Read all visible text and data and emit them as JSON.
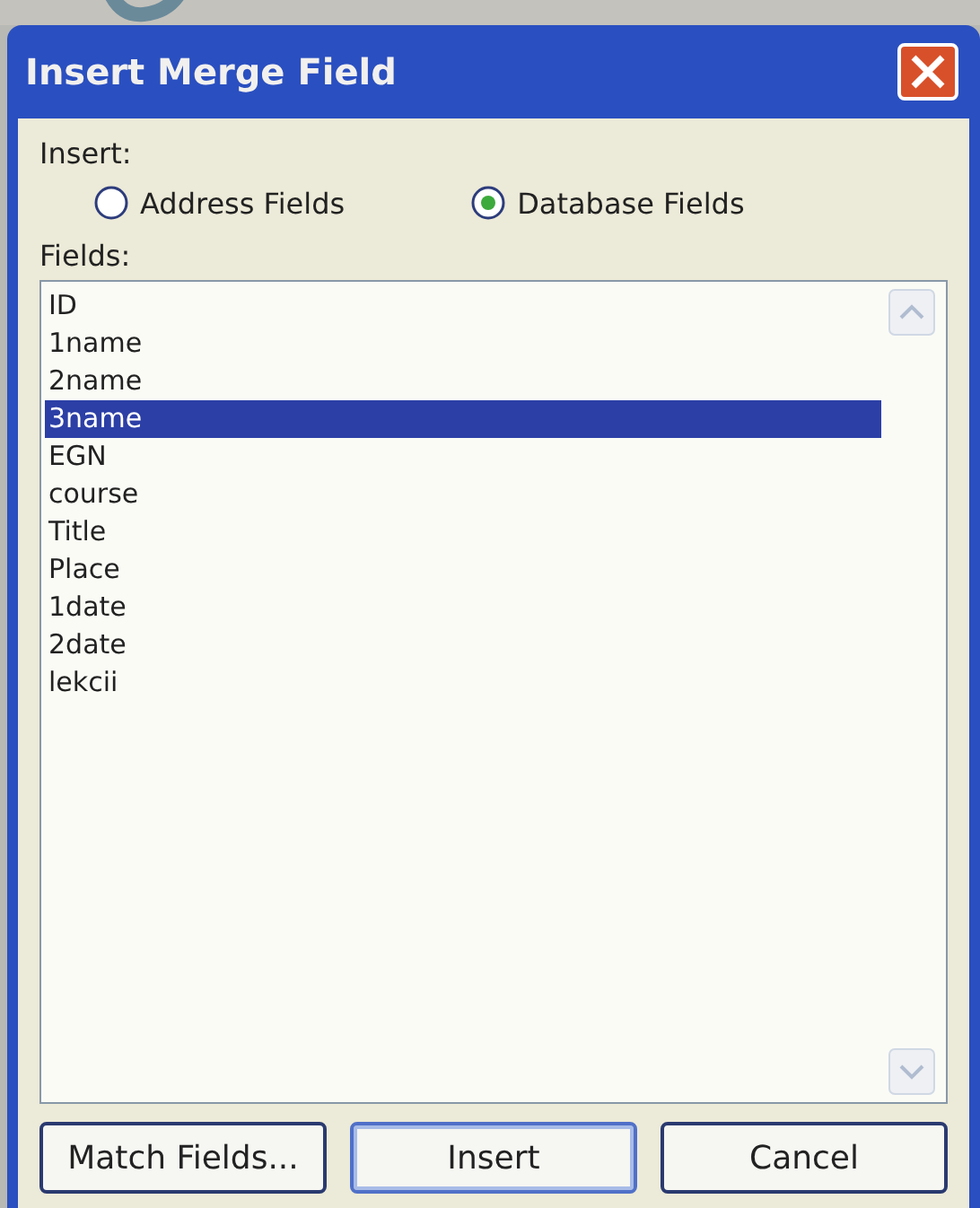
{
  "window": {
    "title": "Insert Merge Field"
  },
  "insert": {
    "label": "Insert:",
    "options": [
      {
        "label": "Address Fields",
        "selected": false
      },
      {
        "label": "Database Fields",
        "selected": true
      }
    ]
  },
  "fields": {
    "label": "Fields:",
    "items": [
      {
        "label": "ID",
        "selected": false
      },
      {
        "label": "1name",
        "selected": false
      },
      {
        "label": "2name",
        "selected": false
      },
      {
        "label": "3name",
        "selected": true
      },
      {
        "label": "EGN",
        "selected": false
      },
      {
        "label": "course",
        "selected": false
      },
      {
        "label": "Title",
        "selected": false
      },
      {
        "label": "Place",
        "selected": false
      },
      {
        "label": "1date",
        "selected": false
      },
      {
        "label": "2date",
        "selected": false
      },
      {
        "label": "lekcii",
        "selected": false
      }
    ]
  },
  "buttons": [
    {
      "label": "Match Fields...",
      "kind": "normal"
    },
    {
      "label": "Insert",
      "kind": "default"
    },
    {
      "label": "Cancel",
      "kind": "normal"
    }
  ]
}
